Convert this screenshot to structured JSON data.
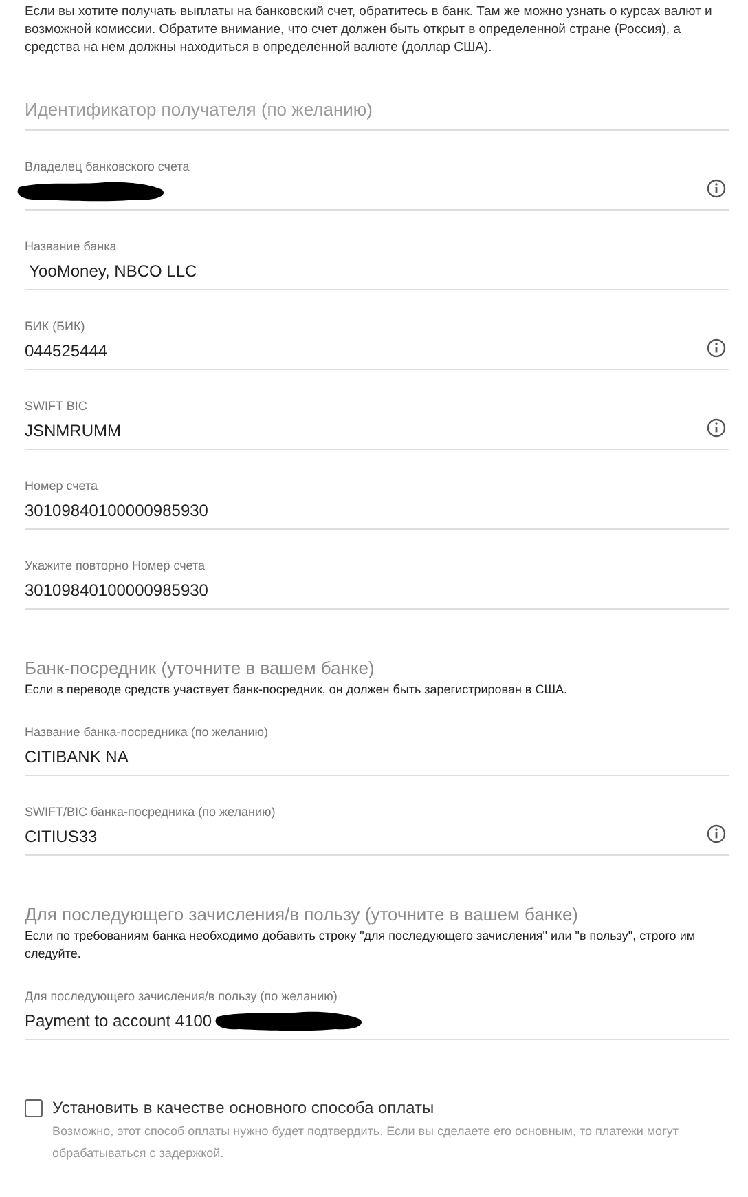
{
  "intro": "Если вы хотите получать выплаты на банковский счет, обратитесь в банк. Там же можно узнать о курсах валют и возможной комиссии. Обратите внимание, что счет должен быть открыт в определенной стране (Россия), а средства на нем должны находиться в определенной валюте (доллар США).",
  "blocks": [
    {
      "kind": "field",
      "placeholder": "Идентификатор получателя (по желанию)"
    },
    {
      "kind": "field",
      "label": "Владелец банковского счета",
      "redacted": true,
      "info": true
    },
    {
      "kind": "field",
      "label": "Название банка",
      "value": " YooMoney, NBCO LLC"
    },
    {
      "kind": "field",
      "label": "БИК (БИК)",
      "value": "044525444",
      "info": true
    },
    {
      "kind": "field",
      "label": "SWIFT BIC",
      "value": "JSNMRUMM",
      "info": true
    },
    {
      "kind": "field",
      "label": "Номер счета",
      "value": "30109840100000985930"
    },
    {
      "kind": "field",
      "label": "Укажите повторно Номер счета",
      "value": "30109840100000985930"
    },
    {
      "kind": "section",
      "title": "Банк-посредник (уточните в вашем банке)",
      "description": "Если в переводе средств участвует банк-посредник, он должен быть зарегистрирован в США."
    },
    {
      "kind": "field",
      "label": "Название банка-посредника (по желанию)",
      "value": "CITIBANK NA"
    },
    {
      "kind": "field",
      "label": "SWIFT/BIC банка-посредника (по желанию)",
      "value": "CITIUS33",
      "info": true
    },
    {
      "kind": "section",
      "title": "Для последующего зачисления/в пользу (уточните в вашем банке)",
      "description": "Если по требованиям банка необходимо добавить строку \"для последующего зачисления\" или \"в пользу\", строго им следуйте."
    },
    {
      "kind": "field",
      "label": "Для последующего зачисления/в пользу (по желанию)",
      "value": "Payment to account 4100",
      "redacted": true
    }
  ],
  "default_option": {
    "label": "Установить в качестве основного способа оплаты",
    "checked": false,
    "description": "Возможно, этот способ оплаты нужно будет подтвердить. Если вы сделаете его основным, то платежи могут обрабатываться с задержкой."
  }
}
